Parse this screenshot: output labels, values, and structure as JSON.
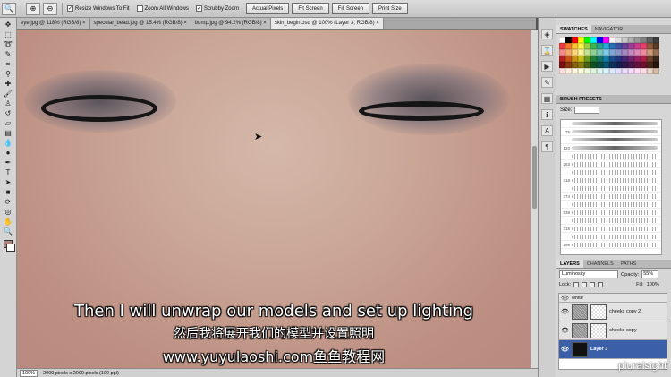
{
  "options_bar": {
    "tool_icon": "zoom-icon",
    "checkboxes": [
      {
        "label": "Resize Windows To Fit",
        "checked": true
      },
      {
        "label": "Zoom All Windows",
        "checked": false
      },
      {
        "label": "Scrubby Zoom",
        "checked": true
      }
    ],
    "buttons": [
      "Actual Pixels",
      "Fit Screen",
      "Fill Screen",
      "Print Size"
    ]
  },
  "doc_tabs": [
    {
      "label": "eye.jpg @ 118% (RGB/8) ×",
      "active": false
    },
    {
      "label": "specular_bead.jpg @ 15.4% (RGB/8) ×",
      "active": false
    },
    {
      "label": "bump.jpg @ 94.2% (RGB/8) ×",
      "active": false
    },
    {
      "label": "skin_begin.psd @ 100% (Layer 3, RGB/8) ×",
      "active": true
    }
  ],
  "status_bar": {
    "zoom": "100%",
    "doc_info": "2000 pixels x 2000 pixels (100 ppi)"
  },
  "subtitles": {
    "english": "Then I will unwrap our models and set up lighting",
    "chinese": "然后我将展开我们的模型并设置照明",
    "watermark": "www.yuyulaoshi.com鱼鱼教程网"
  },
  "swatches_panel": {
    "tabs": [
      "SWATCHES",
      "NAVIGATOR"
    ],
    "colors": [
      "#ffffff",
      "#000000",
      "#ff0000",
      "#ffff00",
      "#00ff00",
      "#00ffff",
      "#0000ff",
      "#ff00ff",
      "#f5f5f5",
      "#e0e0e0",
      "#c8c8c8",
      "#b0b0b0",
      "#989898",
      "#808080",
      "#606060",
      "#404040",
      "#ee3b3b",
      "#f47a2a",
      "#f9c530",
      "#fff54a",
      "#9bd147",
      "#3fb34f",
      "#28a28f",
      "#27a9d9",
      "#2b6fb6",
      "#3c4fa3",
      "#6a3f9b",
      "#9a3f96",
      "#c93d8a",
      "#e53e6a",
      "#8b5a3c",
      "#5d3a24",
      "#f28b8b",
      "#f7a96a",
      "#fcd97a",
      "#fff7a0",
      "#c3e28e",
      "#8ed08f",
      "#79c7b8",
      "#7fcbea",
      "#7fa6d6",
      "#8a92c8",
      "#a686bf",
      "#c388bd",
      "#de88b6",
      "#ef89a1",
      "#c89a78",
      "#9a6e50",
      "#b51f1f",
      "#c45517",
      "#c79416",
      "#c9bf16",
      "#6b9a21",
      "#1f7e33",
      "#137368",
      "#147ba4",
      "#1a4b86",
      "#23327a",
      "#462574",
      "#6f246e",
      "#961f63",
      "#aa1e45",
      "#6b4129",
      "#3c2517",
      "#7a1010",
      "#86380c",
      "#88620c",
      "#897f0c",
      "#476613",
      "#115320",
      "#0b4d45",
      "#0b536f",
      "#0f325a",
      "#151f52",
      "#2e164e",
      "#4b1549",
      "#651241",
      "#71102c",
      "#47291a",
      "#26170e",
      "#ffdede",
      "#ffeedd",
      "#fff8dd",
      "#ffffdd",
      "#eef8dd",
      "#ddf5dd",
      "#ddf5ee",
      "#ddf5ff",
      "#dde8ff",
      "#e0ddff",
      "#eeddff",
      "#f8ddff",
      "#ffddf2",
      "#ffdde6",
      "#e8d4c4",
      "#d4bba4"
    ]
  },
  "brush_panel": {
    "title": "BRUSH PRESETS",
    "size_label": "Size:",
    "brushes": [
      {
        "size": "",
        "kind": "solid"
      },
      {
        "size": "75",
        "kind": "solid"
      },
      {
        "size": "",
        "kind": "solid"
      },
      {
        "size": "120",
        "kind": "solid"
      },
      {
        "size": "",
        "kind": "speck"
      },
      {
        "size": "263",
        "kind": "speck"
      },
      {
        "size": "",
        "kind": "speck"
      },
      {
        "size": "318",
        "kind": "speck"
      },
      {
        "size": "",
        "kind": "speck"
      },
      {
        "size": "374",
        "kind": "speck"
      },
      {
        "size": "",
        "kind": "speck"
      },
      {
        "size": "538",
        "kind": "speck"
      },
      {
        "size": "",
        "kind": "speck"
      },
      {
        "size": "318",
        "kind": "speck"
      },
      {
        "size": "",
        "kind": "speck"
      },
      {
        "size": "298",
        "kind": "speck"
      }
    ]
  },
  "layers_panel": {
    "tabs": [
      "LAYERS",
      "CHANNELS",
      "PATHS"
    ],
    "blend_mode": "Luminosity",
    "opacity_label": "Opacity:",
    "opacity": "55%",
    "lock_label": "Lock:",
    "fill_label": "Fill:",
    "fill": "100%",
    "layers": [
      {
        "name": "white",
        "thumb": "tex",
        "active": false,
        "short": true
      },
      {
        "name": "cheeks copy 2",
        "thumb": "tex",
        "active": false,
        "short": false
      },
      {
        "name": "cheeks copy",
        "thumb": "tex",
        "active": false,
        "short": false
      },
      {
        "name": "Layer 3",
        "thumb": "dark",
        "active": true,
        "short": false
      }
    ]
  },
  "logo": "pluralsight"
}
